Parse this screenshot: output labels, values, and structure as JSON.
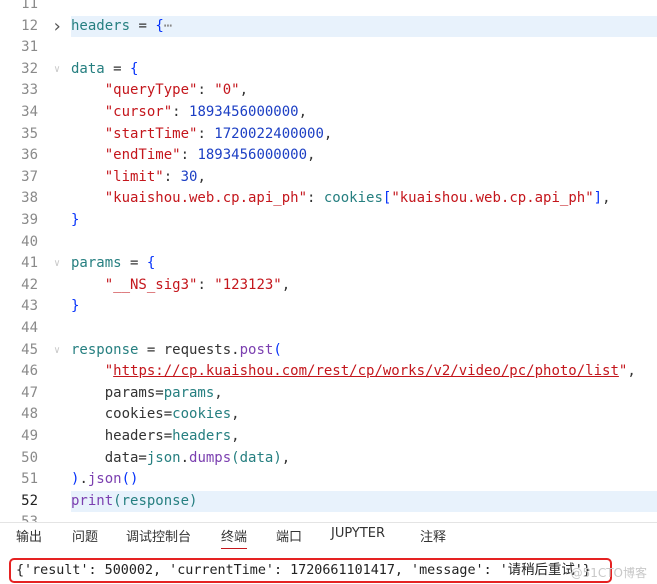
{
  "editor": {
    "lines": [
      {
        "num": "11",
        "tokens": []
      },
      {
        "num": "12",
        "fold": "closed",
        "highlight": true,
        "tokens": [
          [
            "v",
            "headers"
          ],
          [
            "p",
            " = "
          ],
          [
            "b",
            "{"
          ],
          [
            "e",
            "⋯"
          ]
        ]
      },
      {
        "num": "31",
        "tokens": []
      },
      {
        "num": "32",
        "fold": "open",
        "tokens": [
          [
            "v",
            "data"
          ],
          [
            "p",
            " = "
          ],
          [
            "b",
            "{"
          ]
        ]
      },
      {
        "num": "33",
        "tokens": [
          [
            "p",
            "    "
          ],
          [
            "s",
            "\"queryType\""
          ],
          [
            "p",
            ": "
          ],
          [
            "s",
            "\"0\""
          ],
          [
            "p",
            ","
          ]
        ]
      },
      {
        "num": "34",
        "tokens": [
          [
            "p",
            "    "
          ],
          [
            "s",
            "\"cursor\""
          ],
          [
            "p",
            ": "
          ],
          [
            "n",
            "1893456000000"
          ],
          [
            "p",
            ","
          ]
        ]
      },
      {
        "num": "35",
        "tokens": [
          [
            "p",
            "    "
          ],
          [
            "s",
            "\"startTime\""
          ],
          [
            "p",
            ": "
          ],
          [
            "n",
            "1720022400000"
          ],
          [
            "p",
            ","
          ]
        ]
      },
      {
        "num": "36",
        "tokens": [
          [
            "p",
            "    "
          ],
          [
            "s",
            "\"endTime\""
          ],
          [
            "p",
            ": "
          ],
          [
            "n",
            "1893456000000"
          ],
          [
            "p",
            ","
          ]
        ]
      },
      {
        "num": "37",
        "tokens": [
          [
            "p",
            "    "
          ],
          [
            "s",
            "\"limit\""
          ],
          [
            "p",
            ": "
          ],
          [
            "n",
            "30"
          ],
          [
            "p",
            ","
          ]
        ]
      },
      {
        "num": "38",
        "tokens": [
          [
            "p",
            "    "
          ],
          [
            "s",
            "\"kuaishou.web.cp.api_ph\""
          ],
          [
            "p",
            ": "
          ],
          [
            "v",
            "cookies"
          ],
          [
            "b",
            "["
          ],
          [
            "s",
            "\"kuaishou.web.cp.api_ph\""
          ],
          [
            "b",
            "]"
          ],
          [
            "p",
            ","
          ]
        ]
      },
      {
        "num": "39",
        "tokens": [
          [
            "b",
            "}"
          ]
        ]
      },
      {
        "num": "40",
        "tokens": []
      },
      {
        "num": "41",
        "fold": "open",
        "tokens": [
          [
            "v",
            "params"
          ],
          [
            "p",
            " = "
          ],
          [
            "b",
            "{"
          ]
        ]
      },
      {
        "num": "42",
        "tokens": [
          [
            "p",
            "    "
          ],
          [
            "s",
            "\"__NS_sig3\""
          ],
          [
            "p",
            ": "
          ],
          [
            "s",
            "\"123123\""
          ],
          [
            "p",
            ","
          ]
        ]
      },
      {
        "num": "43",
        "tokens": [
          [
            "b",
            "}"
          ]
        ]
      },
      {
        "num": "44",
        "tokens": []
      },
      {
        "num": "45",
        "fold": "open",
        "tokens": [
          [
            "v",
            "response"
          ],
          [
            "p",
            " = "
          ],
          [
            "p",
            "requests."
          ],
          [
            "f",
            "post"
          ],
          [
            "b",
            "("
          ]
        ]
      },
      {
        "num": "46",
        "tokens": [
          [
            "p",
            "    "
          ],
          [
            "s",
            "\""
          ],
          [
            "u",
            "https://cp.kuaishou.com/rest/cp/works/v2/video/pc/photo/list"
          ],
          [
            "s",
            "\""
          ],
          [
            "p",
            ","
          ]
        ]
      },
      {
        "num": "47",
        "tokens": [
          [
            "p",
            "    params="
          ],
          [
            "v",
            "params"
          ],
          [
            "p",
            ","
          ]
        ]
      },
      {
        "num": "48",
        "tokens": [
          [
            "p",
            "    cookies="
          ],
          [
            "v",
            "cookies"
          ],
          [
            "p",
            ","
          ]
        ]
      },
      {
        "num": "49",
        "tokens": [
          [
            "p",
            "    headers="
          ],
          [
            "v",
            "headers"
          ],
          [
            "p",
            ","
          ]
        ]
      },
      {
        "num": "50",
        "tokens": [
          [
            "p",
            "    data="
          ],
          [
            "v",
            "json"
          ],
          [
            "p",
            "."
          ],
          [
            "f",
            "dumps"
          ],
          [
            "v",
            "("
          ],
          [
            "v",
            "data"
          ],
          [
            "v",
            ")"
          ],
          [
            "p",
            ","
          ]
        ]
      },
      {
        "num": "51",
        "tokens": [
          [
            "b",
            ")"
          ],
          [
            "p",
            "."
          ],
          [
            "f",
            "json"
          ],
          [
            "b",
            "()"
          ]
        ]
      },
      {
        "num": "52",
        "current": true,
        "highlight": true,
        "tokens": [
          [
            "f",
            "print"
          ],
          [
            "v",
            "("
          ],
          [
            "v",
            "response"
          ],
          [
            "v",
            ")"
          ]
        ]
      },
      {
        "num": "53",
        "tokens": []
      }
    ]
  },
  "panel": {
    "tabs": [
      {
        "label": "输出",
        "active": false
      },
      {
        "label": "问题",
        "active": false
      },
      {
        "label": "调试控制台",
        "active": false
      },
      {
        "label": "终端",
        "active": true
      },
      {
        "label": "端口",
        "active": false
      },
      {
        "label": "JUPYTER",
        "active": false
      },
      {
        "label": "注释",
        "active": false
      }
    ],
    "output": "{'result': 500002, 'currentTime': 1720661101417, 'message': '请稍后重试'}",
    "watermark": "@51CTO博客"
  },
  "colors": {
    "variable": "#267f80",
    "string": "#c4161c",
    "number": "#1c3fc4",
    "bracket": "#0431fa",
    "function": "#7b3fb0",
    "highlight_box": "#e52222"
  }
}
